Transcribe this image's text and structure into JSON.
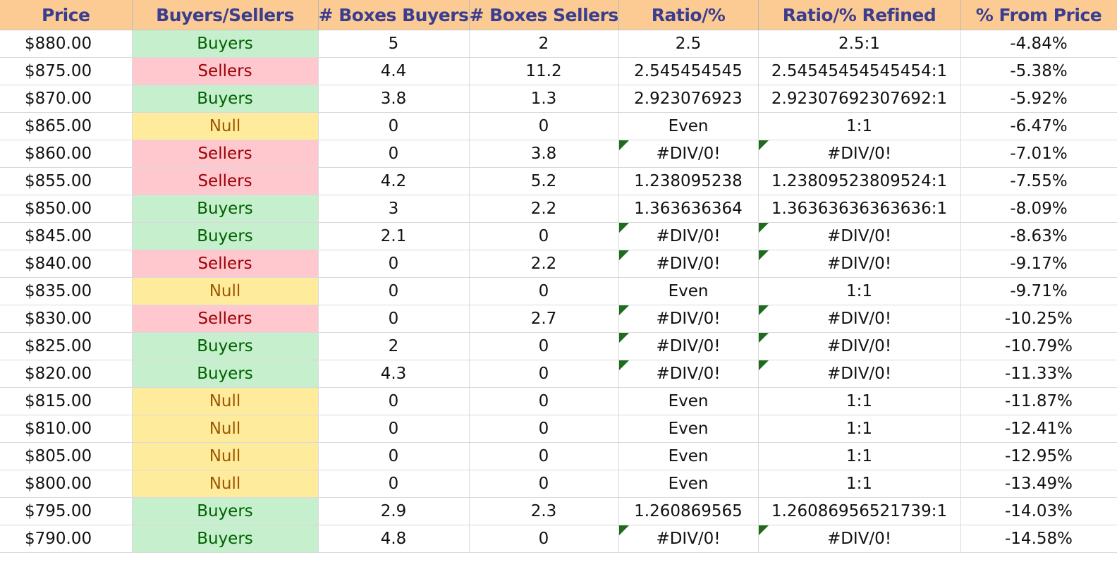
{
  "headers": [
    "Price",
    "Buyers/Sellers",
    "# Boxes Buyers",
    "# Boxes Sellers",
    "Ratio/%",
    "Ratio/% Refined",
    "% From Price"
  ],
  "colors": {
    "header_bg": "#fccb94",
    "header_text": "#3b3e8f",
    "buyers_bg": "#c6efce",
    "buyers_text": "#006100",
    "sellers_bg": "#ffc7ce",
    "sellers_text": "#9c0006",
    "null_bg": "#ffeb9c",
    "null_text": "#9c5700",
    "error_flag": "#1e6b1e"
  },
  "rows": [
    {
      "price": "$880.00",
      "side": "Buyers",
      "boxes_buyers": "5",
      "boxes_sellers": "2",
      "ratio": "2.5",
      "refined": "2.5:1",
      "pct": "-4.84%",
      "error": false
    },
    {
      "price": "$875.00",
      "side": "Sellers",
      "boxes_buyers": "4.4",
      "boxes_sellers": "11.2",
      "ratio": "2.545454545",
      "refined": "2.54545454545454:1",
      "pct": "-5.38%",
      "error": false
    },
    {
      "price": "$870.00",
      "side": "Buyers",
      "boxes_buyers": "3.8",
      "boxes_sellers": "1.3",
      "ratio": "2.923076923",
      "refined": "2.92307692307692:1",
      "pct": "-5.92%",
      "error": false
    },
    {
      "price": "$865.00",
      "side": "Null",
      "boxes_buyers": "0",
      "boxes_sellers": "0",
      "ratio": "Even",
      "refined": "1:1",
      "pct": "-6.47%",
      "error": false
    },
    {
      "price": "$860.00",
      "side": "Sellers",
      "boxes_buyers": "0",
      "boxes_sellers": "3.8",
      "ratio": "#DIV/0!",
      "refined": "#DIV/0!",
      "pct": "-7.01%",
      "error": true
    },
    {
      "price": "$855.00",
      "side": "Sellers",
      "boxes_buyers": "4.2",
      "boxes_sellers": "5.2",
      "ratio": "1.238095238",
      "refined": "1.23809523809524:1",
      "pct": "-7.55%",
      "error": false
    },
    {
      "price": "$850.00",
      "side": "Buyers",
      "boxes_buyers": "3",
      "boxes_sellers": "2.2",
      "ratio": "1.363636364",
      "refined": "1.36363636363636:1",
      "pct": "-8.09%",
      "error": false
    },
    {
      "price": "$845.00",
      "side": "Buyers",
      "boxes_buyers": "2.1",
      "boxes_sellers": "0",
      "ratio": "#DIV/0!",
      "refined": "#DIV/0!",
      "pct": "-8.63%",
      "error": true
    },
    {
      "price": "$840.00",
      "side": "Sellers",
      "boxes_buyers": "0",
      "boxes_sellers": "2.2",
      "ratio": "#DIV/0!",
      "refined": "#DIV/0!",
      "pct": "-9.17%",
      "error": true
    },
    {
      "price": "$835.00",
      "side": "Null",
      "boxes_buyers": "0",
      "boxes_sellers": "0",
      "ratio": "Even",
      "refined": "1:1",
      "pct": "-9.71%",
      "error": false
    },
    {
      "price": "$830.00",
      "side": "Sellers",
      "boxes_buyers": "0",
      "boxes_sellers": "2.7",
      "ratio": "#DIV/0!",
      "refined": "#DIV/0!",
      "pct": "-10.25%",
      "error": true
    },
    {
      "price": "$825.00",
      "side": "Buyers",
      "boxes_buyers": "2",
      "boxes_sellers": "0",
      "ratio": "#DIV/0!",
      "refined": "#DIV/0!",
      "pct": "-10.79%",
      "error": true
    },
    {
      "price": "$820.00",
      "side": "Buyers",
      "boxes_buyers": "4.3",
      "boxes_sellers": "0",
      "ratio": "#DIV/0!",
      "refined": "#DIV/0!",
      "pct": "-11.33%",
      "error": true
    },
    {
      "price": "$815.00",
      "side": "Null",
      "boxes_buyers": "0",
      "boxes_sellers": "0",
      "ratio": "Even",
      "refined": "1:1",
      "pct": "-11.87%",
      "error": false
    },
    {
      "price": "$810.00",
      "side": "Null",
      "boxes_buyers": "0",
      "boxes_sellers": "0",
      "ratio": "Even",
      "refined": "1:1",
      "pct": "-12.41%",
      "error": false
    },
    {
      "price": "$805.00",
      "side": "Null",
      "boxes_buyers": "0",
      "boxes_sellers": "0",
      "ratio": "Even",
      "refined": "1:1",
      "pct": "-12.95%",
      "error": false
    },
    {
      "price": "$800.00",
      "side": "Null",
      "boxes_buyers": "0",
      "boxes_sellers": "0",
      "ratio": "Even",
      "refined": "1:1",
      "pct": "-13.49%",
      "error": false
    },
    {
      "price": "$795.00",
      "side": "Buyers",
      "boxes_buyers": "2.9",
      "boxes_sellers": "2.3",
      "ratio": "1.260869565",
      "refined": "1.26086956521739:1",
      "pct": "-14.03%",
      "error": false
    },
    {
      "price": "$790.00",
      "side": "Buyers",
      "boxes_buyers": "4.8",
      "boxes_sellers": "0",
      "ratio": "#DIV/0!",
      "refined": "#DIV/0!",
      "pct": "-14.58%",
      "error": true
    }
  ]
}
